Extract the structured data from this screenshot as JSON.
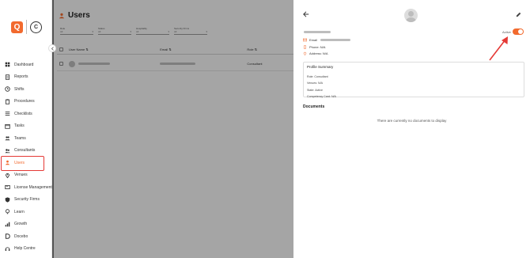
{
  "sidebar": {
    "logo_letter": "Q",
    "logo_mark": "C",
    "items": [
      {
        "label": "Dashboard",
        "icon": "grid-icon"
      },
      {
        "label": "Reports",
        "icon": "document-icon"
      },
      {
        "label": "Shifts",
        "icon": "clock-icon"
      },
      {
        "label": "Procedures",
        "icon": "clipboard-icon"
      },
      {
        "label": "Checklists",
        "icon": "list-icon"
      },
      {
        "label": "Tasks",
        "icon": "calendar-icon"
      },
      {
        "label": "Teams",
        "icon": "group-icon"
      },
      {
        "label": "Consultants",
        "icon": "people-icon"
      },
      {
        "label": "Users",
        "icon": "user-icon",
        "active": true
      },
      {
        "label": "Venues",
        "icon": "pin-icon"
      },
      {
        "label": "License Management",
        "icon": "license-icon"
      },
      {
        "label": "Security Firms",
        "icon": "shield-icon"
      },
      {
        "label": "Learn",
        "icon": "bulb-icon"
      },
      {
        "label": "Growth",
        "icon": "bar-chart-icon"
      },
      {
        "label": "Docebo",
        "icon": "docebo-icon"
      },
      {
        "label": "Help Centre",
        "icon": "headset-icon"
      }
    ]
  },
  "main": {
    "title": "Users",
    "filters": [
      {
        "label": "Role",
        "value": "All"
      },
      {
        "label": "Status",
        "value": "All"
      },
      {
        "label": "Hospitality",
        "value": "All"
      },
      {
        "label": "Security Firms",
        "value": "All"
      }
    ],
    "columns": [
      "User Name",
      "Email",
      "Role"
    ],
    "rows": [
      {
        "role": "Consultant"
      }
    ]
  },
  "drawer": {
    "active_label": "Active",
    "email_label": "Email",
    "phone_label": "Phone: N/A",
    "address_label": "Address: N/A",
    "summary": {
      "title": "Profile Summary",
      "rows": [
        "Role: Consultant",
        "Venues: N/A",
        "State: Active",
        "Competency Card: N/A"
      ]
    },
    "documents_title": "Documents",
    "documents_empty": "There are currently no documents to display"
  },
  "colors": {
    "accent": "#f26a2e",
    "highlight": "#e53935"
  }
}
